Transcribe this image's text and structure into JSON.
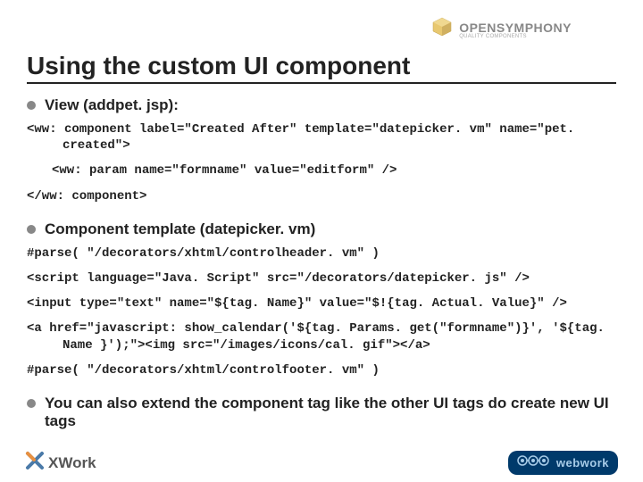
{
  "header": {
    "logo_main": "OPENSYMPHONY",
    "logo_sub": "QUALITY COMPONENTS"
  },
  "title": "Using the custom UI component",
  "sections": [
    {
      "heading": "View (addpet. jsp):",
      "code": [
        "<ww: component label=\"Created After\" template=\"datepicker. vm\" name=\"pet. created\">",
        "<ww: param name=\"formname\" value=\"editform\" />",
        "</ww: component>"
      ]
    },
    {
      "heading": "Component template (datepicker. vm)",
      "code": [
        "#parse( \"/decorators/xhtml/controlheader. vm\" )",
        "<script language=\"Java. Script\" src=\"/decorators/datepicker. js\" />",
        "<input type=\"text\" name=\"${tag. Name}\" value=\"$!{tag. Actual. Value}\" />",
        "<a href=\"javascript: show_calendar('${tag. Params. get(\"formname\")}', '${tag. Name }');\"><img src=\"/images/icons/cal. gif\"></a>",
        "#parse( \"/decorators/xhtml/controlfooter. vm\" )"
      ]
    },
    {
      "heading": "You can also extend the component tag like the other UI tags do create new UI tags",
      "code": []
    }
  ],
  "footer": {
    "xwork": "XWork",
    "webwork": "webwork"
  }
}
